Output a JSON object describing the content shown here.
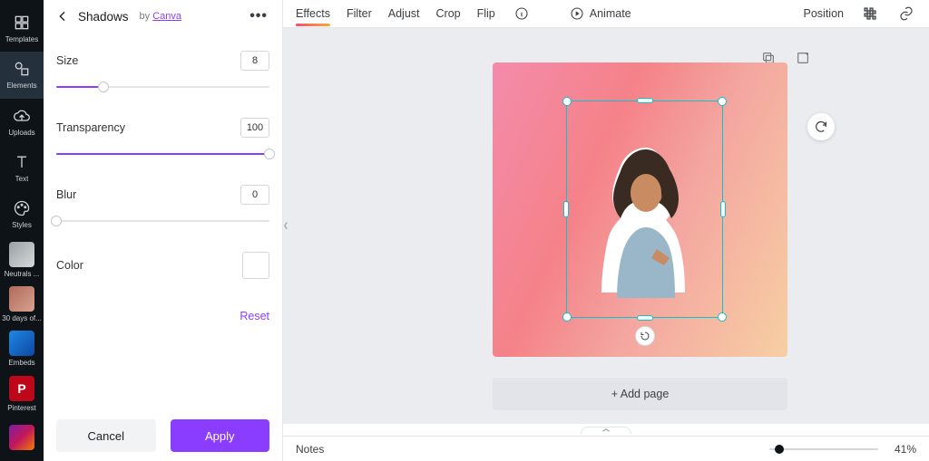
{
  "rail": {
    "items": [
      {
        "label": "Templates",
        "name": "templates"
      },
      {
        "label": "Elements",
        "name": "elements"
      },
      {
        "label": "Uploads",
        "name": "uploads"
      },
      {
        "label": "Text",
        "name": "text"
      },
      {
        "label": "Styles",
        "name": "styles"
      }
    ],
    "apps": [
      {
        "label": "Neutrals ...",
        "class": "gray",
        "name": "neutrals"
      },
      {
        "label": "30 days of...",
        "class": "reddish",
        "name": "30days"
      },
      {
        "label": "Embeds",
        "class": "blue",
        "name": "embeds"
      },
      {
        "label": "Pinterest",
        "class": "pin",
        "name": "pinterest"
      },
      {
        "label": "",
        "class": "rainbow",
        "name": "more-apps"
      }
    ]
  },
  "panel": {
    "title": "Shadows",
    "by": "by",
    "by_link": "Canva",
    "props": {
      "size": {
        "label": "Size",
        "value": "8",
        "pct": 22
      },
      "transparency": {
        "label": "Transparency",
        "value": "100",
        "pct": 100
      },
      "blur": {
        "label": "Blur",
        "value": "0",
        "pct": 0
      }
    },
    "color_label": "Color",
    "reset": "Reset",
    "cancel": "Cancel",
    "apply": "Apply"
  },
  "topbar": {
    "tabs": {
      "effects": "Effects",
      "filter": "Filter",
      "adjust": "Adjust",
      "crop": "Crop",
      "flip": "Flip"
    },
    "animate": "Animate",
    "position": "Position"
  },
  "canvas": {
    "add_page": "+ Add page"
  },
  "footer": {
    "notes": "Notes",
    "zoom_text": "41%",
    "zoom_pct": 9
  }
}
